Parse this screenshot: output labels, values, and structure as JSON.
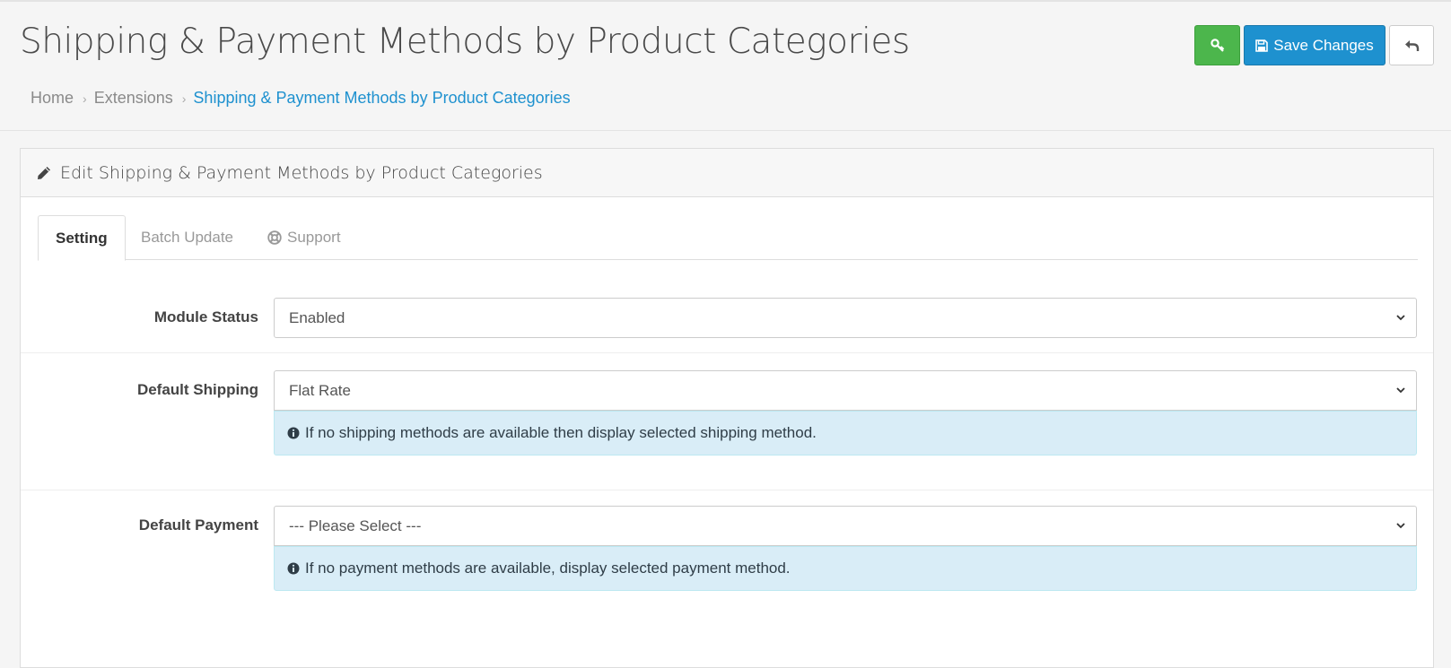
{
  "header": {
    "title": "Shipping & Payment Methods by Product Categories",
    "breadcrumb": [
      "Home",
      "Extensions",
      "Shipping & Payment Methods by Product Categories"
    ],
    "buttons": {
      "key_icon": "key-icon",
      "save_label": "Save Changes",
      "back_icon": "reply-icon"
    }
  },
  "panel": {
    "title": "Edit Shipping & Payment Methods by Product Categories",
    "tabs": [
      {
        "label": "Setting",
        "active": true
      },
      {
        "label": "Batch Update",
        "active": false
      },
      {
        "label": "Support",
        "active": false,
        "icon": "life-ring-icon"
      }
    ]
  },
  "form": {
    "module_status": {
      "label": "Module Status",
      "value": "Enabled"
    },
    "default_shipping": {
      "label": "Default Shipping",
      "value": "Flat Rate",
      "help": "If no shipping methods are available then display selected shipping method."
    },
    "default_payment": {
      "label": "Default Payment",
      "value": "--- Please Select ---",
      "help": "If no payment methods are available, display selected payment method."
    }
  },
  "colors": {
    "primary": "#1e91cf",
    "success": "#4cb64c",
    "info_bg": "#d9edf7"
  }
}
